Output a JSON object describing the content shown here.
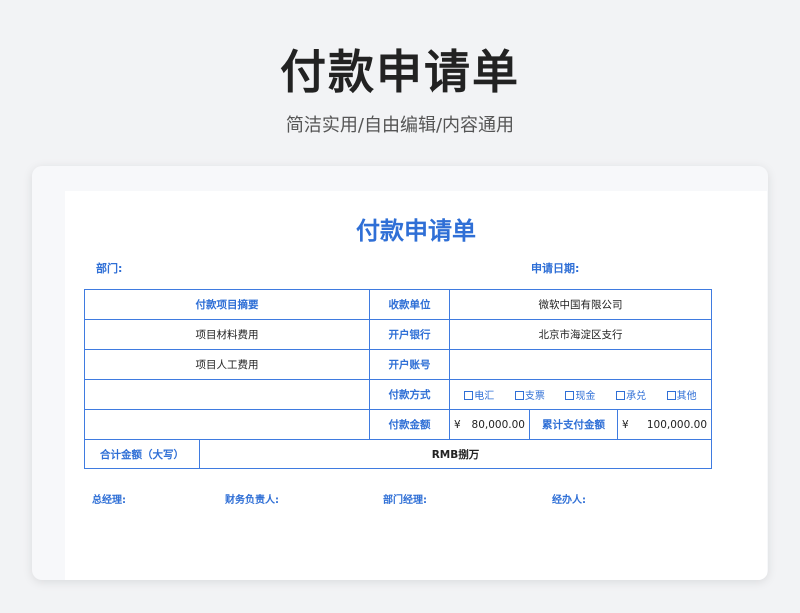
{
  "page": {
    "title": "付款申请单",
    "subtitle": "简洁实用/自由编辑/内容通用"
  },
  "form": {
    "title": "付款申请单",
    "department_label": "部门:",
    "date_label": "申请日期:",
    "header": {
      "summary_label": "付款项目摘要",
      "payee_label": "收款单位",
      "payee_value": "微软中国有限公司"
    },
    "rows": [
      {
        "item": "项目材料费用",
        "label": "开户银行",
        "value": "北京市海淀区支行"
      },
      {
        "item": "项目人工费用",
        "label": "开户账号",
        "value": ""
      }
    ],
    "payment_method_label": "付款方式",
    "payment_options": [
      {
        "label": "电汇",
        "icon": "checkbox-icon"
      },
      {
        "label": "支票",
        "icon": "checkbox-icon"
      },
      {
        "label": "现金",
        "icon": "checkbox-icon"
      },
      {
        "label": "承兑",
        "icon": "checkbox-icon"
      },
      {
        "label": "其他",
        "icon": "checkbox-icon"
      }
    ],
    "amount_label": "付款金额",
    "currency_symbol": "¥",
    "amount_value": "80,000.00",
    "cumulative_label": "累计支付金额",
    "cumulative_value": "100,000.00",
    "total_label": "合计金额（大写）",
    "total_value": "RMB捌万",
    "signatures": {
      "gm": "总经理:",
      "finance": "财务负责人:",
      "dept_manager": "部门经理:",
      "handler": "经办人:"
    }
  },
  "colors": {
    "accent": "#2f6fd6",
    "border": "#3f7be0",
    "background": "#f2f3f5"
  }
}
